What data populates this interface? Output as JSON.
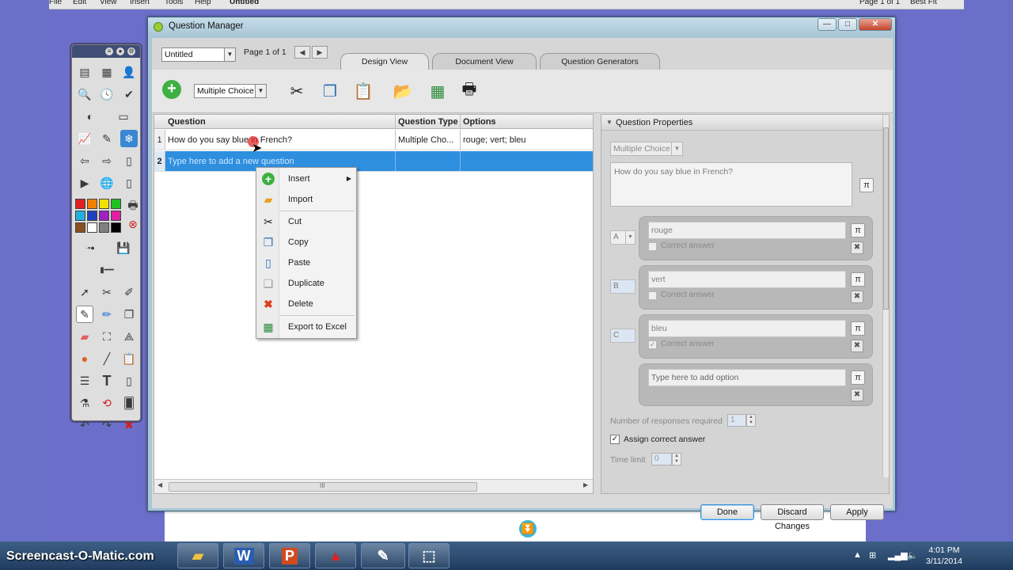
{
  "app_menu": {
    "items": [
      "File",
      "Edit",
      "View",
      "Insert",
      "Tools",
      "Help"
    ],
    "doc_tab": "Untitled",
    "page_label": "Page 1 of 1",
    "zoom": "Best Fit"
  },
  "window": {
    "title": "Question Manager",
    "minimize": "—",
    "maximize": "□",
    "close": "✕"
  },
  "top_bar": {
    "doc_select": "Untitled",
    "page_label": "Page 1 of 1",
    "prev": "◀",
    "next": "▶",
    "tabs": [
      {
        "label": "Design View"
      },
      {
        "label": "Document View"
      },
      {
        "label": "Question Generators"
      }
    ]
  },
  "toolbar": {
    "question_type": "Multiple Choice",
    "icons": [
      "add-icon",
      "cut-icon",
      "copy-icon",
      "paste-icon",
      "import-icon",
      "export-excel-icon",
      "print-icon"
    ]
  },
  "grid": {
    "columns": [
      "Question",
      "Question Type",
      "Options"
    ],
    "rows": [
      {
        "num": "1",
        "question": "How do you say blue in French?",
        "type": "Multiple Cho...",
        "options": "rouge; vert; bleu"
      },
      {
        "num": "2",
        "question": "Type here to add a new question",
        "type": "",
        "options": ""
      }
    ],
    "hscroll_grip": "III"
  },
  "context_menu": {
    "items": [
      {
        "label": "Insert",
        "icon": "insert-icon",
        "submenu": "▶"
      },
      {
        "label": "Import",
        "icon": "folder-icon"
      },
      {
        "label": "Cut",
        "icon": "cut-icon"
      },
      {
        "label": "Copy",
        "icon": "copy-icon"
      },
      {
        "label": "Paste",
        "icon": "paste-icon"
      },
      {
        "label": "Duplicate",
        "icon": "duplicate-icon"
      },
      {
        "label": "Delete",
        "icon": "delete-icon"
      },
      {
        "label": "Export to Excel",
        "icon": "excel-icon"
      }
    ]
  },
  "properties": {
    "header": "Question Properties",
    "type": "Multiple Choice",
    "question_text": "How do you say blue in French?",
    "pi_symbol": "π",
    "options": [
      {
        "letter": "A",
        "text": "rouge",
        "correct": false
      },
      {
        "letter": "B",
        "text": "vert",
        "correct": false
      },
      {
        "letter": "C",
        "text": "bleu",
        "correct": true
      }
    ],
    "correct_label": "Correct answer",
    "add_option_placeholder": "Type here to add option",
    "responses_label": "Number of responses required",
    "responses_value": "1",
    "assign_correct_label": "Assign correct answer",
    "time_limit_label": "Time limit",
    "time_limit_value": "0"
  },
  "buttons": {
    "done": "Done",
    "discard": "Discard Changes",
    "apply": "Apply"
  },
  "taskbar": {
    "watermark": "Screencast-O-Matic.com",
    "time": "4:01 PM",
    "date": "3/11/2014"
  },
  "colors": {
    "desktop": "#6a70c8",
    "selection": "#2f8fdf",
    "window_frame": "#a9c7d8"
  }
}
